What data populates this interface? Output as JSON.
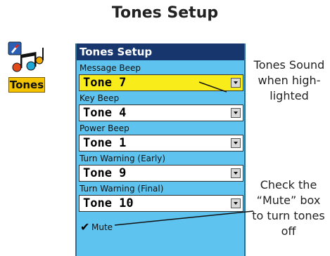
{
  "page": {
    "title": "Tones Setup"
  },
  "app_icon": {
    "name": "tones-app-icon",
    "caption": "Tones"
  },
  "screen": {
    "title": "Tones Setup",
    "rows": [
      {
        "label": "Message Beep",
        "value": "Tone 7",
        "highlighted": true
      },
      {
        "label": "Key Beep",
        "value": "Tone 4",
        "highlighted": false
      },
      {
        "label": "Power Beep",
        "value": "Tone 1",
        "highlighted": false
      },
      {
        "label": "Turn Warning (Early)",
        "value": "Tone 9",
        "highlighted": false
      },
      {
        "label": "Turn Warning (Final)",
        "value": "Tone 10",
        "highlighted": false
      }
    ],
    "mute": {
      "label": "Mute",
      "checked": true
    }
  },
  "callouts": {
    "highlight_note": [
      "Tones Sound",
      "when high-",
      "lighted"
    ],
    "mute_note": [
      "Check the",
      "“Mute” box",
      "to turn tones",
      "off"
    ]
  },
  "colors": {
    "screen_bg": "#5ec4ef",
    "title_bar": "#17366e",
    "highlight": "#f8ec1a",
    "icon_caption_bg": "#f4c400"
  }
}
